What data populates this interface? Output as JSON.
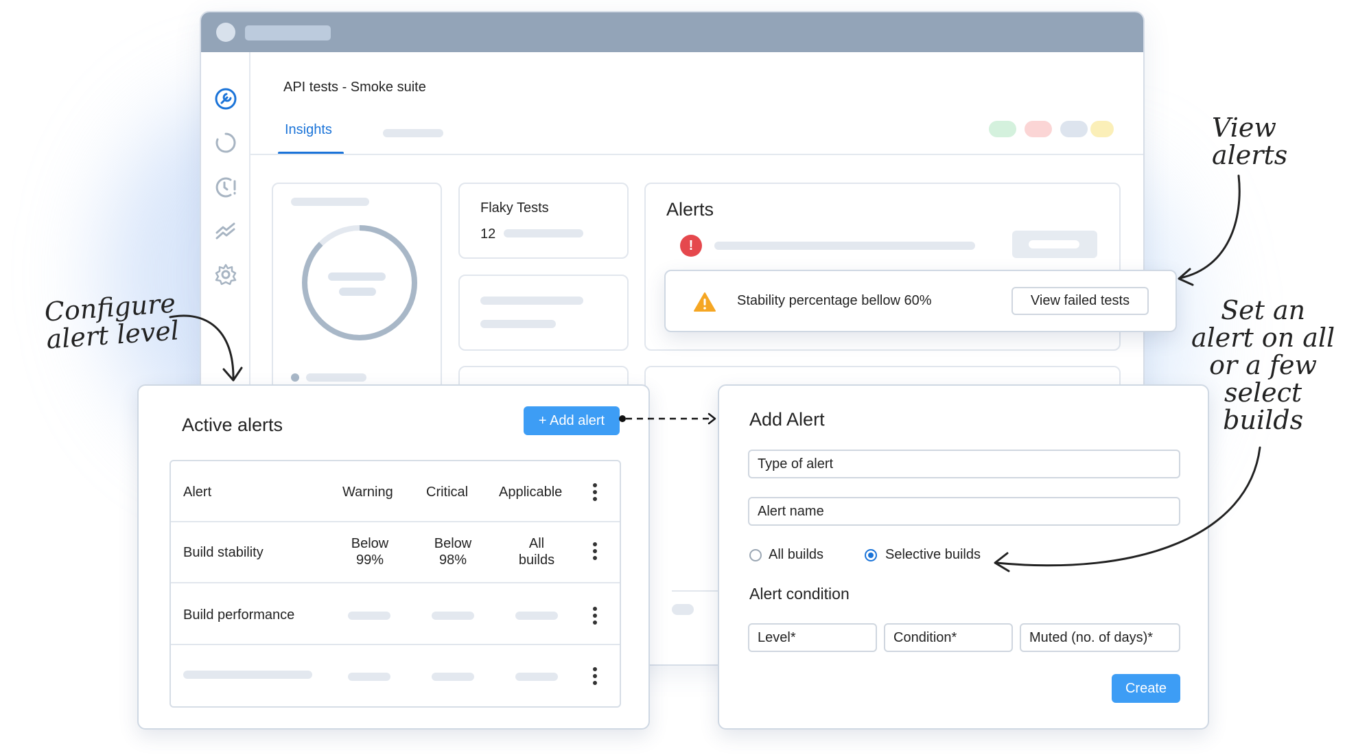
{
  "window": {
    "page_title": "API tests - Smoke suite",
    "tabs": [
      "Insights"
    ]
  },
  "flaky_card": {
    "title": "Flaky Tests",
    "value": "12"
  },
  "alerts_card": {
    "title": "Alerts",
    "alert_message": "Stability percentage bellow 60%",
    "view_button": "View failed tests"
  },
  "active_alerts": {
    "title": "Active alerts",
    "add_button": "+ Add alert",
    "columns": [
      "Alert",
      "Warning",
      "Critical",
      "Applicable"
    ],
    "rows": [
      {
        "alert": "Build stability",
        "warning": [
          "Below",
          "99%"
        ],
        "critical": [
          "Below",
          "98%"
        ],
        "applicable": [
          "All",
          "builds"
        ]
      },
      {
        "alert": "Build performance"
      }
    ]
  },
  "add_alert": {
    "title": "Add Alert",
    "type_field": "Type of alert",
    "name_field": "Alert name",
    "radio_all": "All builds",
    "radio_selective": "Selective builds",
    "selected_radio": "Selective builds",
    "condition_title": "Alert condition",
    "level_field": "Level*",
    "condition_field": "Condition*",
    "muted_field": "Muted (no. of days)*",
    "create_button": "Create"
  },
  "annotations": {
    "view_alerts": [
      "View",
      "alerts"
    ],
    "configure": [
      "Configure",
      "alert level"
    ],
    "set_alert": [
      "Set an",
      "alert on all",
      "or a few",
      "select",
      "builds"
    ]
  },
  "colors": {
    "accent": "#1a73d8",
    "button_blue": "#3d9df5",
    "titlebar": "#93a4b8",
    "warning": "#f5a623",
    "error": "#e5484d"
  }
}
